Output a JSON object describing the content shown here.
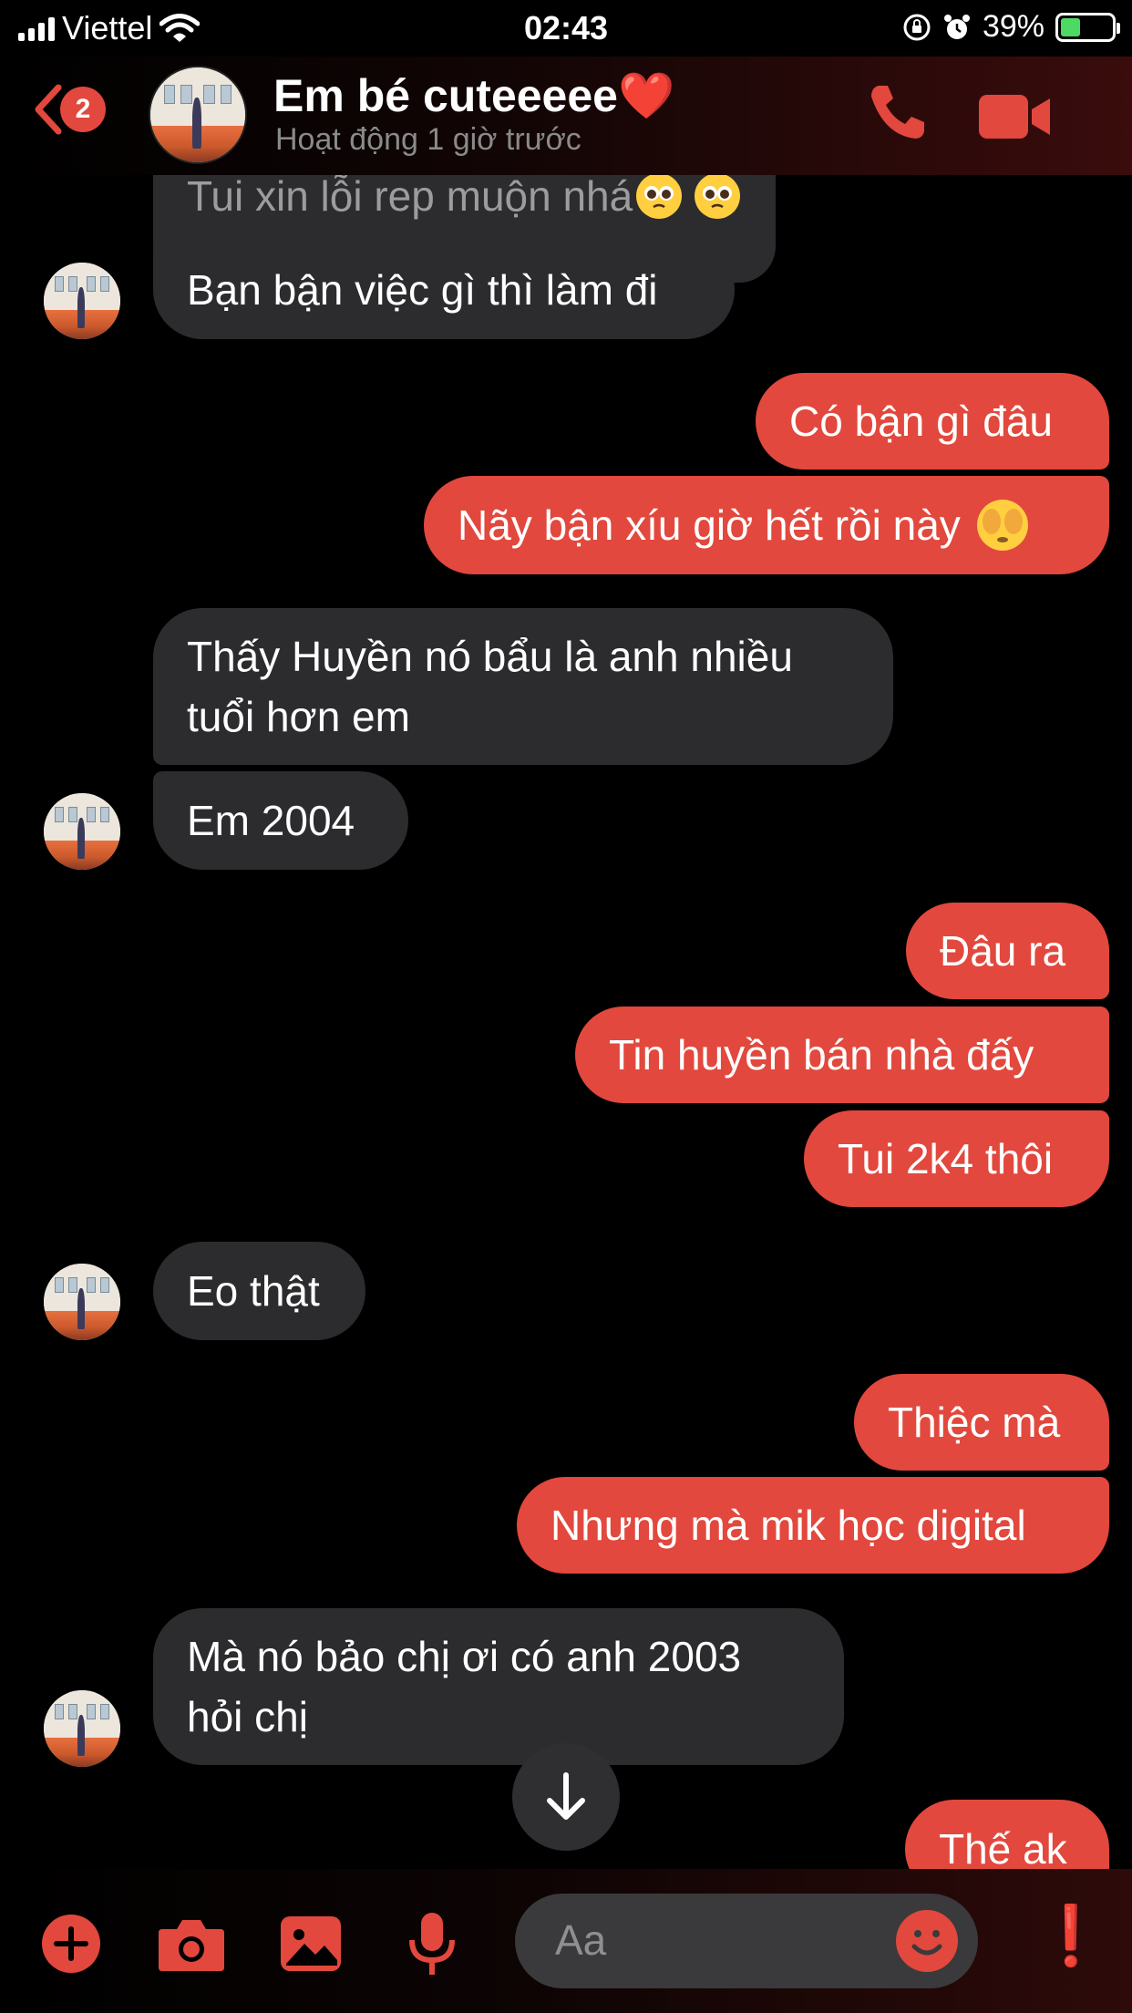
{
  "status_bar": {
    "carrier": "Viettel",
    "time": "02:43",
    "battery_percent": "39%",
    "battery_level": 0.39
  },
  "header": {
    "back_badge": "2",
    "title": "Em bé cuteeeee",
    "title_emoji": "❤️",
    "subtitle": "Hoạt động 1 giờ trước"
  },
  "messages": [
    {
      "side": "in",
      "text": "Tui xin lỗi rep muộn nhá",
      "emoji": [
        "pleading-face",
        "pleading-face"
      ]
    },
    {
      "side": "in",
      "text": "Bạn bận việc gì thì làm đi"
    },
    {
      "side": "out",
      "text": "Có bận gì đâu"
    },
    {
      "side": "out",
      "text": "Nãy bận xíu giờ hết rồi này",
      "emoji": [
        "see-no-evil-face"
      ]
    },
    {
      "side": "in",
      "line1": "Thấy Huyền nó bẩu là anh nhiều",
      "line2": "tuổi hơn em"
    },
    {
      "side": "in",
      "text": "Em 2004"
    },
    {
      "side": "out",
      "text": "Đâu ra"
    },
    {
      "side": "out",
      "text": "Tin huyền bán nhà đấy"
    },
    {
      "side": "out",
      "text": "Tui 2k4 thôi"
    },
    {
      "side": "in",
      "text": "Eo thật"
    },
    {
      "side": "out",
      "text": "Thiệc mà"
    },
    {
      "side": "out",
      "text": "Nhưng mà mik học digital"
    },
    {
      "side": "in",
      "line1": "Mà nó bảo chị ơi có anh 2003",
      "line2": "hỏi chị"
    },
    {
      "side": "out",
      "text": "Thế ak"
    }
  ],
  "composer": {
    "placeholder": "Aa",
    "like_emoji": "❗"
  },
  "colors": {
    "accent": "#e2483d",
    "incoming_bubble": "#2c2c2e",
    "background": "#000000"
  },
  "icons": [
    "back-chevron-icon",
    "phone-icon",
    "video-camera-icon",
    "arrow-down-icon",
    "plus-icon",
    "camera-icon",
    "image-icon",
    "microphone-icon",
    "smiley-icon",
    "heart-exclamation-icon"
  ]
}
